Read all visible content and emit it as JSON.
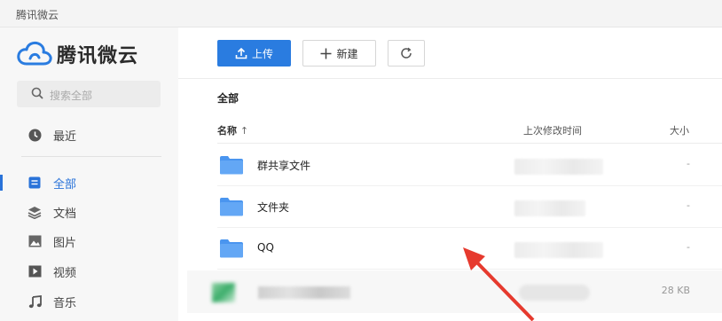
{
  "window": {
    "title": "腾讯微云"
  },
  "sidebar": {
    "logo_text": "腾讯微云",
    "search_placeholder": "搜索全部",
    "recent": {
      "label": "最近",
      "icon": "clock-icon"
    },
    "items": [
      {
        "label": "全部",
        "icon": "doc-list-icon",
        "active": true
      },
      {
        "label": "文档",
        "icon": "layers-icon",
        "active": false
      },
      {
        "label": "图片",
        "icon": "image-icon",
        "active": false
      },
      {
        "label": "视频",
        "icon": "play-icon",
        "active": false
      },
      {
        "label": "音乐",
        "icon": "music-note-icon",
        "active": false
      }
    ],
    "accent": "#2a73d9"
  },
  "toolbar": {
    "upload_label": "上传",
    "new_label": "新建",
    "upload_color": "#2a7ce0"
  },
  "breadcrumb": "全部",
  "table": {
    "columns": {
      "name": "名称",
      "modified": "上次修改时间",
      "size": "大小"
    },
    "rows": [
      {
        "name": "群共享文件",
        "size": "-"
      },
      {
        "name": "文件夹",
        "size": "-"
      },
      {
        "name": "QQ",
        "size": "-"
      }
    ],
    "last_row_size": "28 KB"
  }
}
